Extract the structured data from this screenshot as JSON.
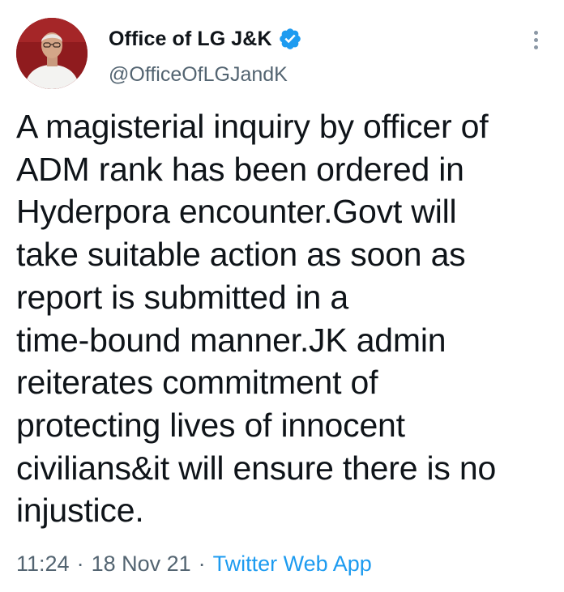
{
  "tweet": {
    "display_name": "Office of LG J&K",
    "handle": "@OfficeOfLGJandK",
    "verified": true,
    "text": "A magisterial inquiry by officer of\nADM rank has been ordered in\nHyderpora encounter.Govt will\ntake suitable action as soon as\nreport is submitted in a\ntime-bound manner.JK admin\nreiterates commitment of\nprotecting lives of innocent\ncivilians&it will ensure there is no\ninjustice.",
    "time": "11:24",
    "date": "18 Nov 21",
    "separator": "·",
    "source": "Twitter Web App"
  },
  "icons": {
    "verified": "verified-badge-icon",
    "more": "more-vertical-icon"
  },
  "colors": {
    "accent": "#1d9bf0",
    "text": "#0f1419",
    "secondary": "#536471",
    "avatar_bg": "#8f1b1e"
  }
}
